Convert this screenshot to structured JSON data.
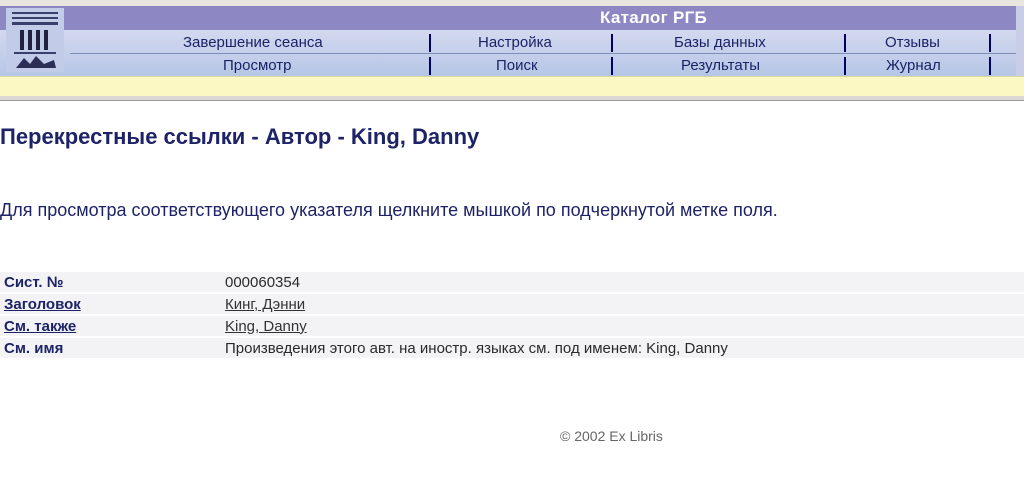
{
  "header": {
    "title": "Каталог РГБ",
    "nav_row1": [
      "Завершение сеанса",
      "Настройка",
      "Базы данных",
      "Отзывы"
    ],
    "nav_row2": [
      "Просмотр",
      "Поиск",
      "Результаты",
      "Журнал"
    ]
  },
  "page": {
    "title": "Перекрестные ссылки - Автор - King, Danny",
    "instruction": "Для просмотра соответствующего указателя щелкните мышкой по подчеркнутой метке поля."
  },
  "record": {
    "rows": [
      {
        "label": "Сист. №",
        "value": "000060354"
      },
      {
        "label": "Заголовок",
        "value": "Кинг, Дэнни "
      },
      {
        "label": "См. также",
        "value": "King, Danny"
      },
      {
        "label": "См. имя",
        "value": "Произведения этого авт. на иностр. языках см. под именем: King, Danny"
      }
    ]
  },
  "footer": {
    "copyright": "© 2002 Ex Libris"
  },
  "colors": {
    "title_band": "#8d88c3",
    "nav_text": "#1b2266",
    "yellow_band": "#fbf8c3"
  }
}
